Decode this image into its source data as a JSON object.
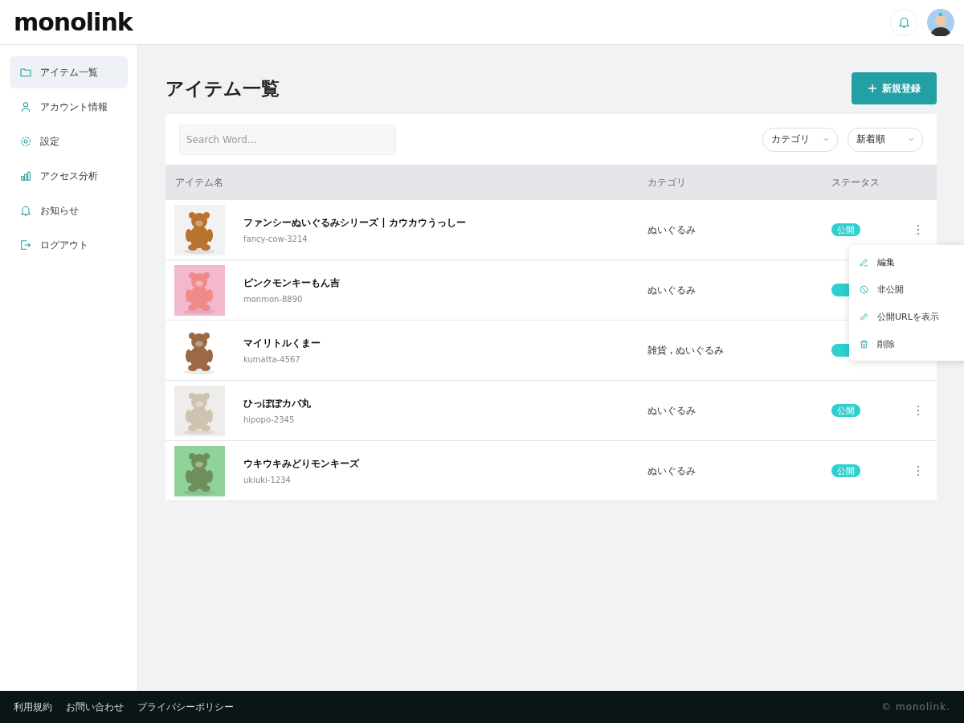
{
  "header": {
    "logo": "monolink"
  },
  "sidebar": {
    "items": [
      {
        "label": "アイテム一覧",
        "kind": "folder",
        "selected": true
      },
      {
        "label": "アカウント情報",
        "kind": "user",
        "selected": false
      },
      {
        "label": "設定",
        "kind": "gear",
        "selected": false
      },
      {
        "label": "アクセス分析",
        "kind": "chart",
        "selected": false
      },
      {
        "label": "お知らせ",
        "kind": "bell",
        "selected": false
      },
      {
        "label": "ログアウト",
        "kind": "logout",
        "selected": false
      }
    ]
  },
  "page": {
    "title": "アイテム一覧",
    "new_button": "新規登録"
  },
  "filters": {
    "search_placeholder": "Search Word...",
    "category": "カテゴリ",
    "sort": "新着順"
  },
  "table": {
    "columns": [
      "アイテム名",
      "カテゴリ",
      "ステータス"
    ],
    "rows": [
      {
        "name": "ファンシーぬいぐるみシリーズ | カウカウうっしー",
        "code": "fancy-cow-3214",
        "category": "ぬいぐるみ",
        "status": "公開"
      },
      {
        "name": "ピンクモンキーもん吉",
        "code": "monmon-8890",
        "category": "ぬいぐるみ"
      },
      {
        "name": "マイリトルくまー",
        "code": "kumatta-4567",
        "category": "雑貨 , ぬいぐるみ"
      },
      {
        "name": "ひっぽぽカバ丸",
        "code": "hipopo-2345",
        "category": "ぬいぐるみ",
        "status": "公開"
      },
      {
        "name": "ウキウキみどりモンキーズ",
        "code": "ukiuki-1234",
        "category": "ぬいぐるみ",
        "status": "公開"
      }
    ]
  },
  "row_menu": {
    "items": [
      {
        "label": "編集",
        "kind": "edit"
      },
      {
        "label": "非公開",
        "kind": "hide"
      },
      {
        "label": "公開URLを表示",
        "kind": "link"
      },
      {
        "label": "削除",
        "kind": "trash"
      }
    ]
  },
  "footer": {
    "links": [
      "利用規約",
      "お問い合わせ",
      "プライバシーポリシー"
    ],
    "copyright": "© monolink."
  }
}
